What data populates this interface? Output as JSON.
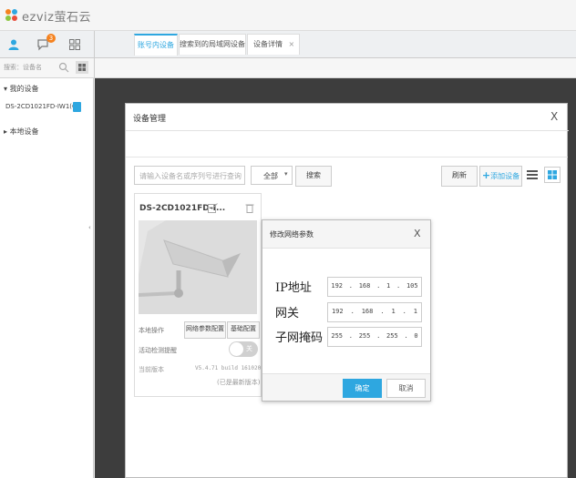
{
  "app": {
    "logo_text": "ezviz萤石云",
    "badge_count": "3"
  },
  "sidebar": {
    "search_placeholder": "搜索：设备名",
    "my_devices": "我的设备",
    "device_item": "DS-2CD1021FD-IW1(C*",
    "local_devices": "本地设备"
  },
  "dialog": {
    "title": "设备管理",
    "close": "X",
    "tabs": [
      "账号内设备",
      "搜索到的局域网设备",
      "设备详情"
    ],
    "tab_close": "×",
    "search_placeholder": "请输入设备名或序列号进行查询",
    "filter_value": "全部",
    "search_button": "搜索",
    "refresh_button": "刷新",
    "add_button": "添加设备",
    "add_icon_glyph": "+"
  },
  "card": {
    "name": "DS-2CD1021FD-I...",
    "local_ops_label": "本地操作",
    "net_params_button": "网络参数配置",
    "restore_button": "基础配置",
    "motion_label": "活动检测提醒",
    "toggle_label": "关",
    "firmware_label": "当前版本",
    "firmware_value": "V5.4.71 build 161020",
    "firmware_note": "(已是最新版本)"
  },
  "net_dialog": {
    "title": "修改网络参数",
    "close": "X",
    "ip_label": "IP地址",
    "gateway_label": "网关",
    "mask_label": "子网掩码",
    "ip": [
      "192",
      "168",
      "1",
      "105"
    ],
    "gateway": [
      "192",
      "168",
      "1",
      "1"
    ],
    "mask": [
      "255",
      "255",
      "255",
      "0"
    ],
    "confirm": "确定",
    "cancel": "取消"
  },
  "colors": {
    "accent": "#2ea7e0",
    "badge": "#f5821f",
    "dark_bg": "#3d3d3d"
  }
}
